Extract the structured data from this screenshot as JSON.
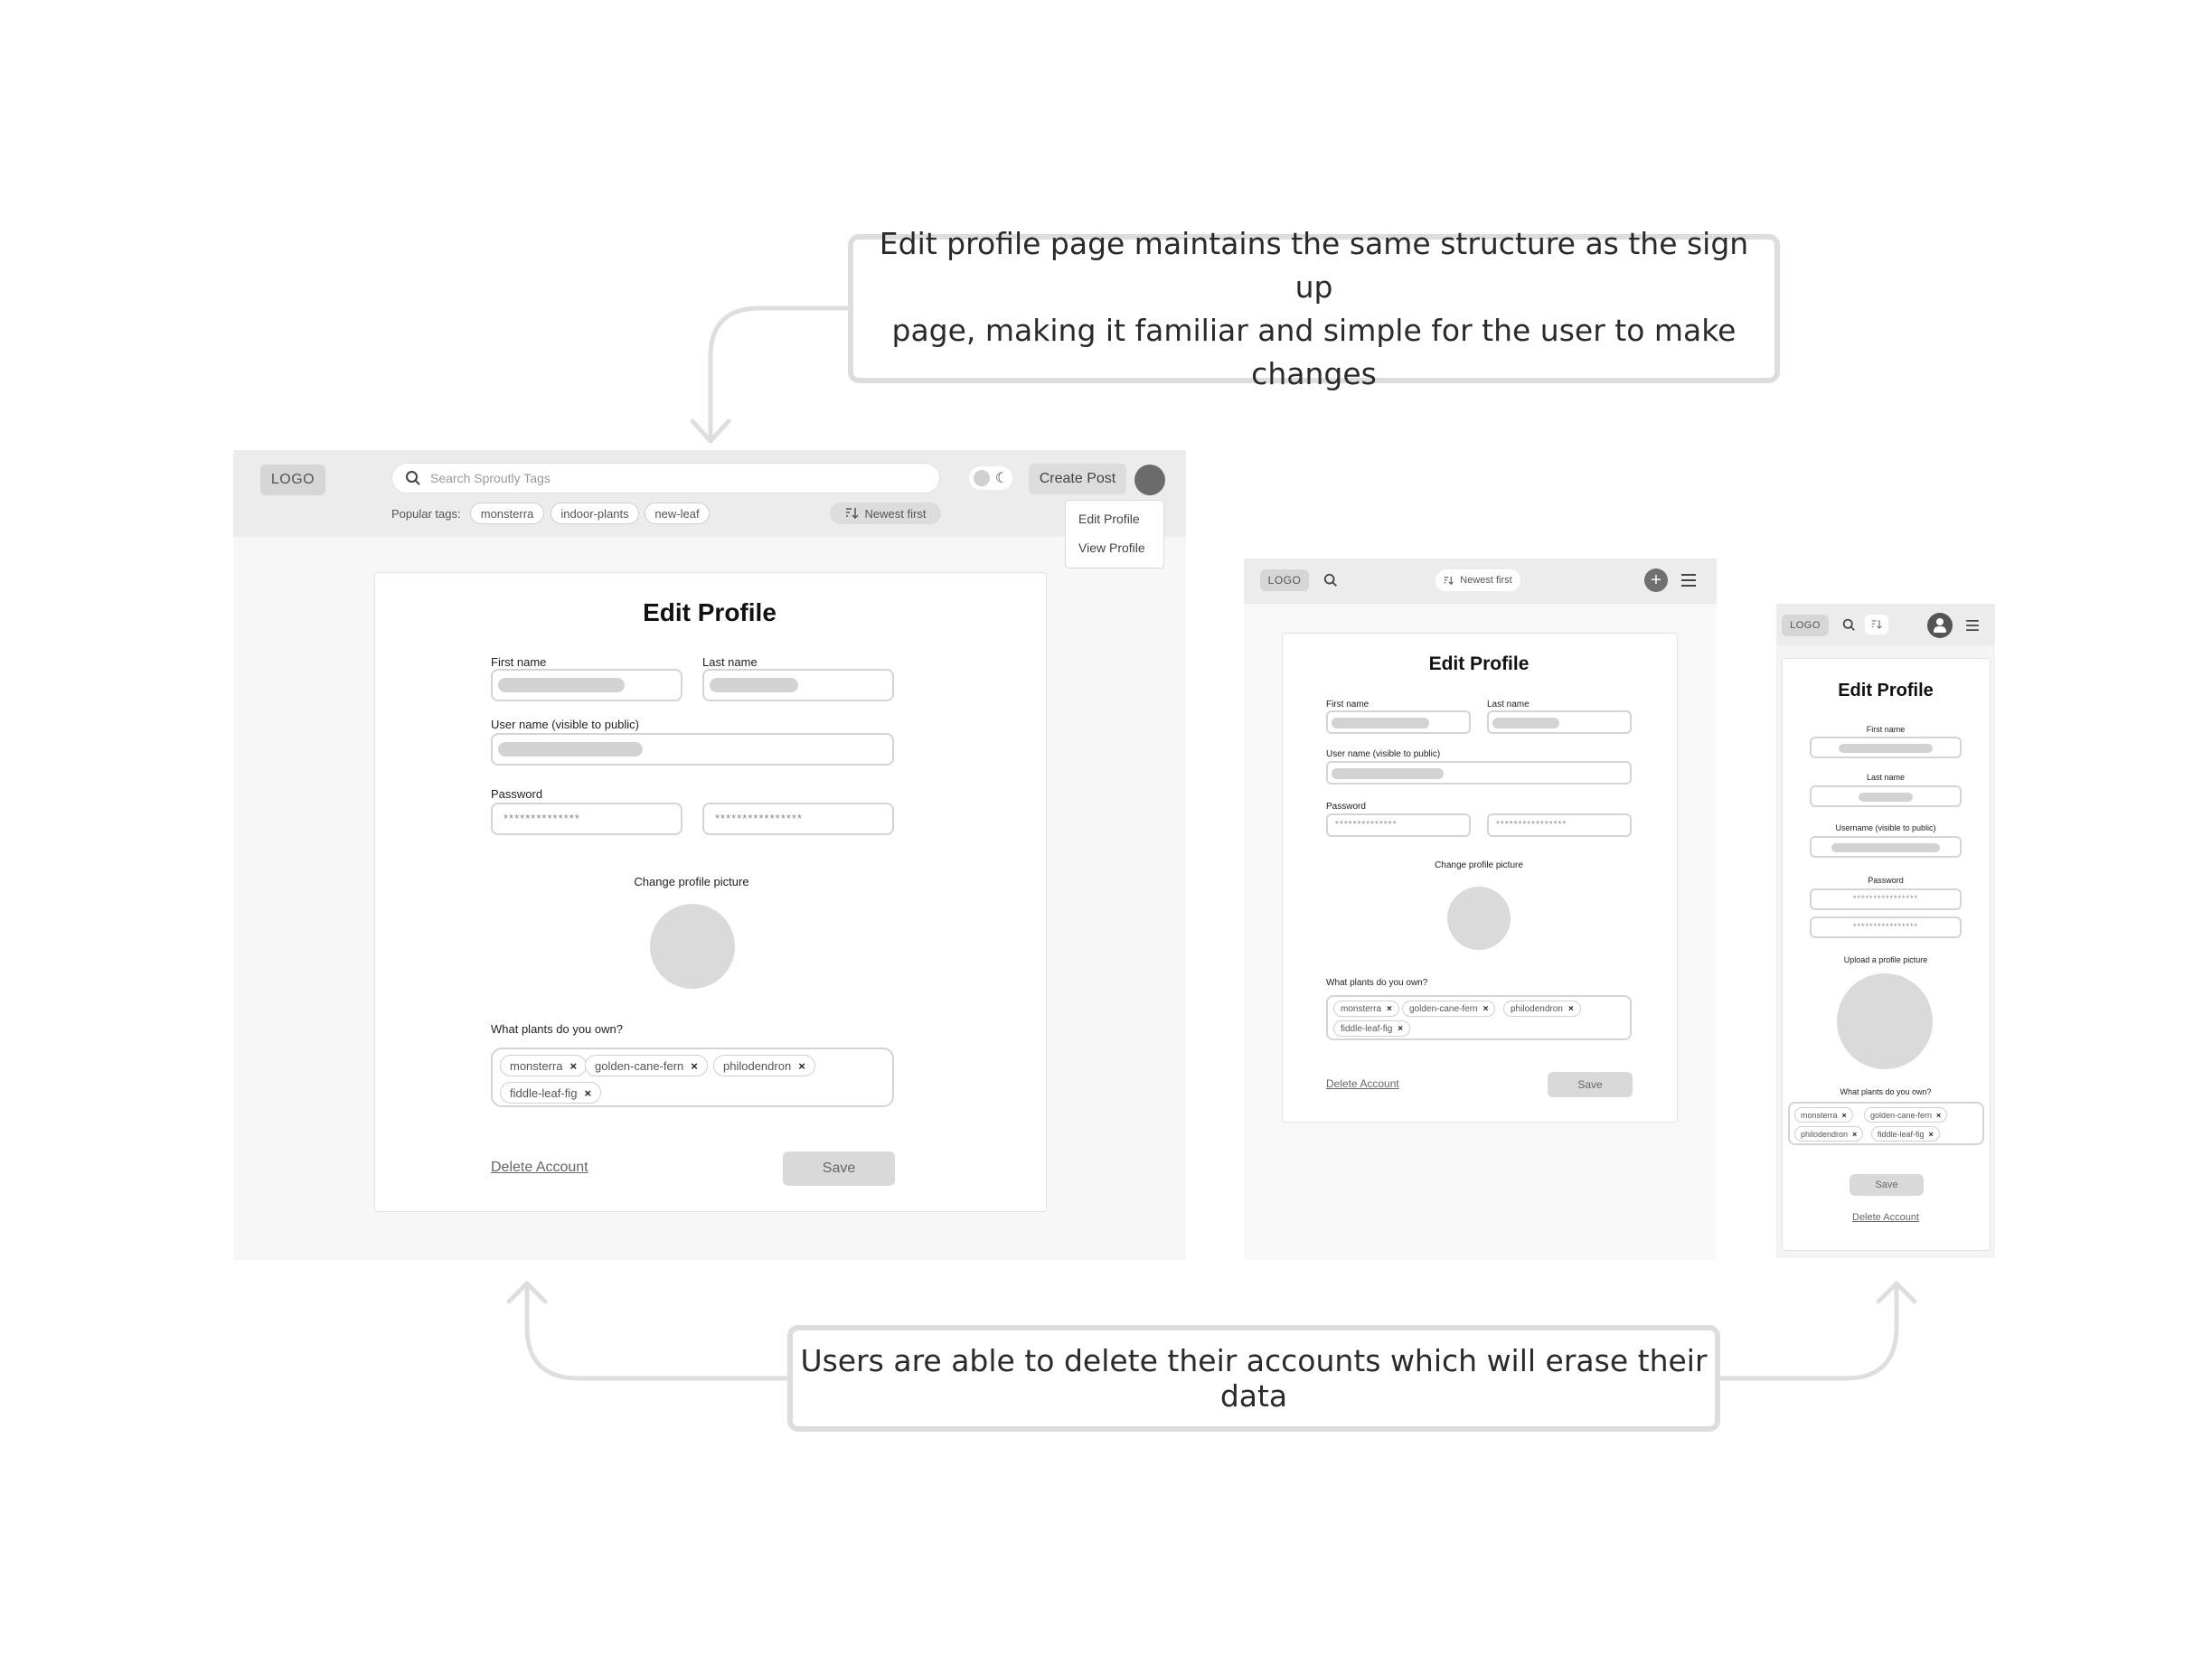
{
  "annotations": {
    "top_line1": "Edit profile page maintains the same structure as the sign up",
    "top_line2": "page, making it familiar and simple for the user to make changes",
    "bottom": "Users are able to delete their accounts which will erase their data"
  },
  "desktop": {
    "logo": "LOGO",
    "search_placeholder": "Search Sproutly Tags",
    "popular_label": "Popular tags:",
    "popular_tags": [
      "monsterra",
      "indoor-plants",
      "new-leaf"
    ],
    "sort": "Newest first",
    "create_post": "Create Post",
    "menu": [
      "Edit Profile",
      "View Profile"
    ],
    "form": {
      "title": "Edit Profile",
      "first_name": "First name",
      "last_name": "Last name",
      "username": "User name (visible to public)",
      "password": "Password",
      "password_mask": "**************",
      "password_mask2": "****************",
      "picture": "Change profile picture",
      "plants_q": "What plants do you own?",
      "plants": [
        "monsterra",
        "golden-cane-fern",
        "philodendron",
        "fiddle-leaf-fig"
      ],
      "delete": "Delete Account",
      "save": "Save"
    }
  },
  "tablet": {
    "logo": "LOGO",
    "sort": "Newest first",
    "form": {
      "title": "Edit Profile",
      "first_name": "First name",
      "last_name": "Last name",
      "username": "User name (visible to public)",
      "password": "Password",
      "password_mask": "**************",
      "password_mask2": "****************",
      "picture": "Change profile picture",
      "plants_q": "What plants do you own?",
      "plants": [
        "monsterra",
        "golden-cane-fern",
        "philodendron",
        "fiddle-leaf-fig"
      ],
      "delete": "Delete Account",
      "save": "Save"
    }
  },
  "mobile": {
    "logo": "LOGO",
    "form": {
      "title": "Edit Profile",
      "first_name": "First name",
      "last_name": "Last name",
      "username": "Username (visible to public)",
      "password": "Password",
      "password_mask": "****************",
      "password_mask2": "****************",
      "picture": "Upload a profile picture",
      "plants_q": "What plants do you own?",
      "plants": [
        "monsterra",
        "golden-cane-fern",
        "philodendron",
        "fiddle-leaf-fig"
      ],
      "save": "Save",
      "delete": "Delete Account"
    }
  }
}
